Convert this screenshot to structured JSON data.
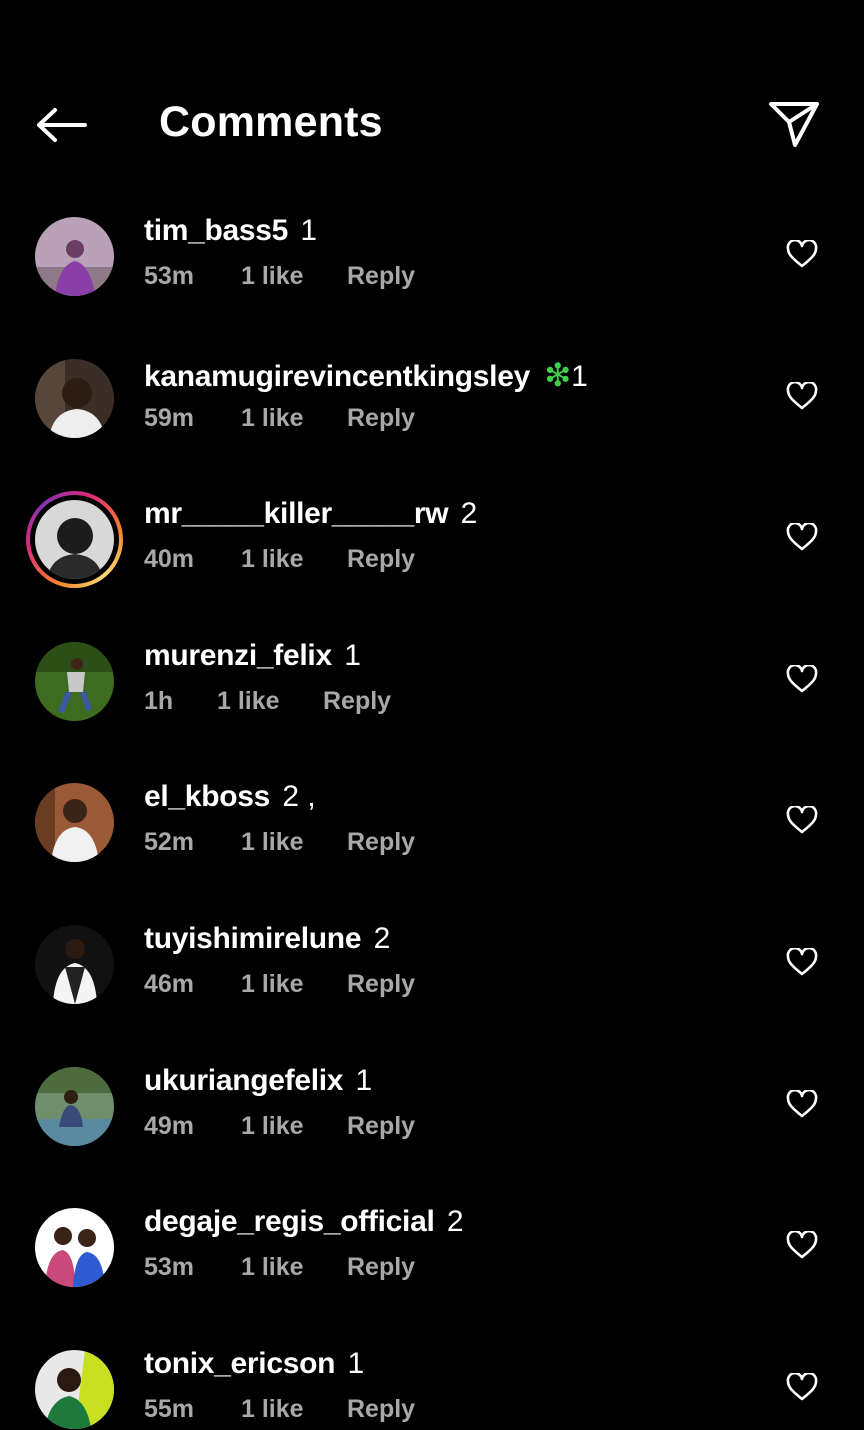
{
  "header": {
    "title": "Comments",
    "back_icon": "arrow-left-icon",
    "share_icon": "paper-plane-icon"
  },
  "comments": [
    {
      "username": "tim_bass5",
      "text": "1",
      "time": "53m",
      "likes": "1 like",
      "reply": "Reply"
    },
    {
      "username": "kanamugirevincentkingsley",
      "text": "1",
      "sparkle": "❇",
      "time": "59m",
      "likes": "1 like",
      "reply": "Reply"
    },
    {
      "username": "mr_____killer_____rw",
      "text": "2",
      "time": "40m",
      "likes": "1 like",
      "reply": "Reply"
    },
    {
      "username": "murenzi_felix",
      "text": "1",
      "time": "1h",
      "likes": "1 like",
      "reply": "Reply"
    },
    {
      "username": "el_kboss",
      "text": "2 ,",
      "time": "52m",
      "likes": "1 like",
      "reply": "Reply"
    },
    {
      "username": "tuyishimirelune",
      "text": "2",
      "time": "46m",
      "likes": "1 like",
      "reply": "Reply"
    },
    {
      "username": "ukuriangefelix",
      "text": "1",
      "time": "49m",
      "likes": "1 like",
      "reply": "Reply"
    },
    {
      "username": "degaje_regis_official",
      "text": "2",
      "time": "53m",
      "likes": "1 like",
      "reply": "Reply"
    },
    {
      "username": "tonix_ericson",
      "text": "1",
      "time": "55m",
      "likes": "1 like",
      "reply": "Reply"
    }
  ],
  "colors": {
    "background": "#000000",
    "text": "#ffffff",
    "meta": "#a8a8a8",
    "sparkle": "#3ecf4b"
  }
}
